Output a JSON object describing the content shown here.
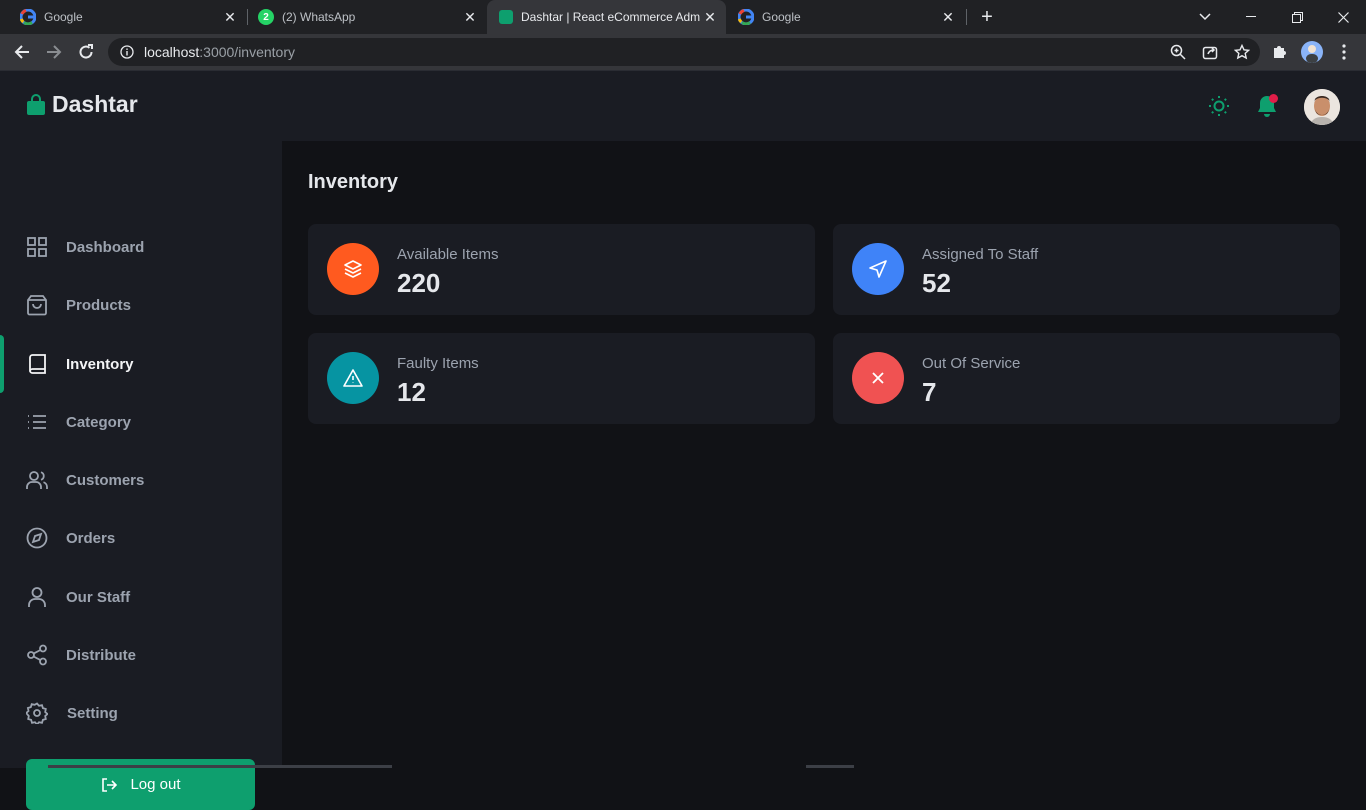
{
  "browser": {
    "tabs": [
      {
        "title": "Google",
        "favicon": "google-icon"
      },
      {
        "title": "(2) WhatsApp",
        "favicon": "whatsapp-icon",
        "badge": "2"
      },
      {
        "title": "Dashtar | React eCommerce Adm",
        "favicon": "dashtar-bag-icon",
        "active": true
      },
      {
        "title": "Google",
        "favicon": "google-icon"
      }
    ],
    "url_host": "localhost",
    "url_path": ":3000/inventory"
  },
  "app": {
    "brand": "Dashtar",
    "accent_color": "#0e9f6e",
    "sidebar": {
      "items": [
        {
          "label": "Dashboard",
          "icon": "grid-icon"
        },
        {
          "label": "Products",
          "icon": "shopping-bag-icon"
        },
        {
          "label": "Inventory",
          "icon": "book-icon",
          "active": true
        },
        {
          "label": "Category",
          "icon": "list-icon"
        },
        {
          "label": "Customers",
          "icon": "users-icon"
        },
        {
          "label": "Orders",
          "icon": "compass-icon"
        },
        {
          "label": "Our Staff",
          "icon": "user-icon"
        },
        {
          "label": "Distribute",
          "icon": "share-icon"
        },
        {
          "label": "Setting",
          "icon": "settings-icon"
        }
      ],
      "logout_label": "Log out"
    },
    "page_title": "Inventory",
    "cards": [
      {
        "label": "Available Items",
        "value": "220",
        "icon": "layers-icon",
        "color": "#ff5a1f"
      },
      {
        "label": "Assigned To Staff",
        "value": "52",
        "icon": "send-icon",
        "color": "#3f83f8"
      },
      {
        "label": "Faulty Items",
        "value": "12",
        "icon": "alert-triangle-icon",
        "color": "#0694a2"
      },
      {
        "label": "Out Of Service",
        "value": "7",
        "icon": "x-icon",
        "color": "#f05252"
      }
    ]
  }
}
